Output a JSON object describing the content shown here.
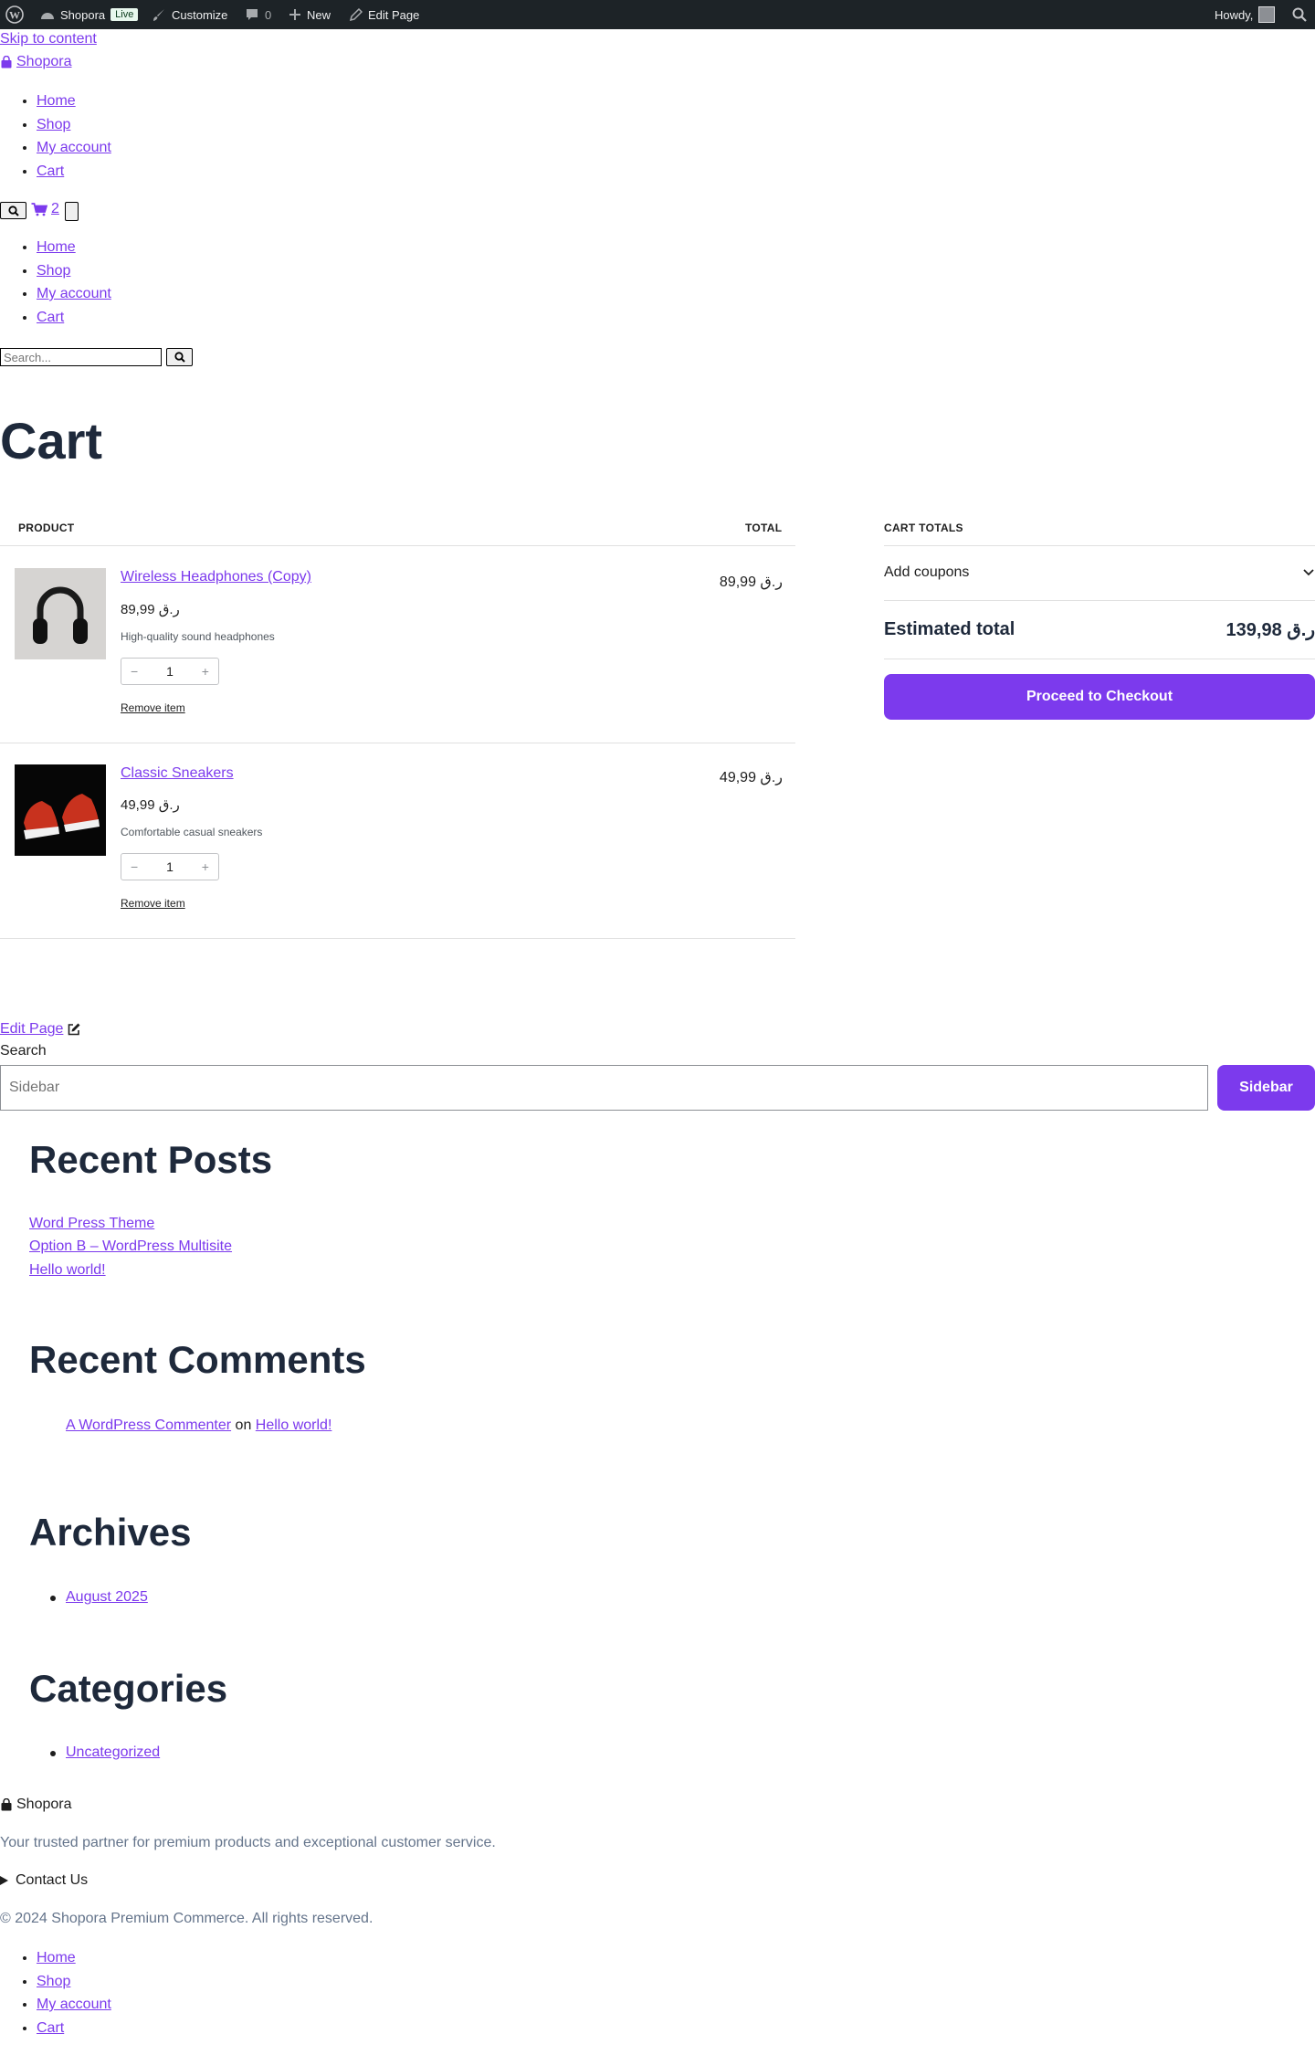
{
  "admin_bar": {
    "site_name": "Shopora",
    "live_badge": "Live",
    "customize": "Customize",
    "comments_count": "0",
    "new_label": "New",
    "edit_page": "Edit Page",
    "howdy": "Howdy,"
  },
  "skip_link": "Skip to content",
  "site_logo": "Shopora",
  "nav": {
    "primary": [
      "Home",
      "Shop",
      "My account",
      "Cart"
    ],
    "mobile": [
      "Home",
      "Shop",
      "My account",
      "Cart"
    ],
    "cart_count": "2"
  },
  "header_search": {
    "placeholder": "Search..."
  },
  "page_title": "Cart",
  "cart": {
    "col_product": "PRODUCT",
    "col_total": "TOTAL",
    "items": [
      {
        "name": "Wireless Headphones (Copy)",
        "price": "89,99 ر.ق",
        "desc": "High-quality sound headphones",
        "qty": "1",
        "remove": "Remove item",
        "total": "89,99 ر.ق",
        "image": "headphones"
      },
      {
        "name": "Classic Sneakers",
        "price": "49,99 ر.ق",
        "desc": "Comfortable casual sneakers",
        "qty": "1",
        "remove": "Remove item",
        "total": "49,99 ر.ق",
        "image": "sneakers"
      }
    ],
    "qty_minus": "−",
    "qty_plus": "+",
    "totals": {
      "heading": "CART TOTALS",
      "coupons": "Add coupons",
      "estimated_label": "Estimated total",
      "estimated_value": "139,98 ر.ق",
      "checkout": "Proceed to Checkout"
    }
  },
  "edit_page_link": "Edit Page",
  "sidebar_search": {
    "label": "Search",
    "placeholder": "Sidebar",
    "button": "Sidebar"
  },
  "widgets": {
    "recent_posts": {
      "title": "Recent Posts",
      "items": [
        "Word Press Theme",
        "Option B – WordPress Multisite",
        "Hello world!"
      ]
    },
    "recent_comments": {
      "title": "Recent Comments",
      "author": "A WordPress Commenter",
      "on": "on",
      "post": "Hello world!"
    },
    "archives": {
      "title": "Archives",
      "items": [
        "August 2025"
      ]
    },
    "categories": {
      "title": "Categories",
      "items": [
        "Uncategorized"
      ]
    }
  },
  "footer": {
    "brand": "Shopora",
    "tagline": "Your trusted partner for premium products and exceptional customer service.",
    "contact": "Contact Us",
    "copyright": "© 2024 Shopora Premium Commerce. All rights reserved.",
    "links": [
      "Home",
      "Shop",
      "My account",
      "Cart"
    ]
  },
  "colors": {
    "accent": "#7c3aed",
    "heading": "#1e293b",
    "admin_bar": "#1d2327"
  }
}
